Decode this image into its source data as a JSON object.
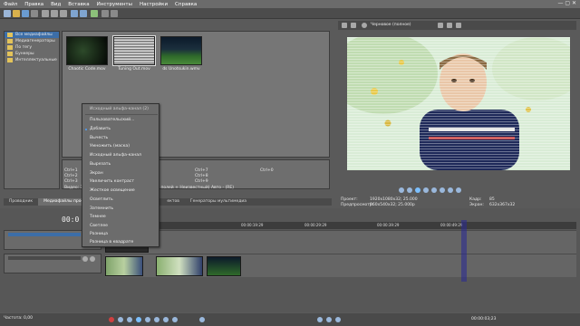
{
  "menu": [
    "Файл",
    "Правка",
    "Вид",
    "Вставка",
    "Инструменты",
    "Настройки",
    "Справка"
  ],
  "explorer": {
    "tree_items": [
      "Все медиафайлы",
      "Медиагенераторы",
      "По тегу",
      "Бункеры",
      "Интеллектуальные"
    ],
    "selected_index": 0
  },
  "media": [
    {
      "label": "Chaotic Code.mov"
    },
    {
      "label": "Tuning Out.mov"
    },
    {
      "label": "ds Unotsukin.wmv"
    }
  ],
  "info": {
    "shortcut_rows": [
      [
        "Ctrl+1",
        "Ctrl+7",
        "Ctrl+0"
      ],
      [
        "Ctrl+2",
        "Ctrl+8",
        ""
      ],
      [
        "Ctrl+3",
        "Ctrl+9",
        ""
      ]
    ],
    "bottom_line": "Видео: 38...  анная + (Отсутствует) Передан полей + Неизвестный) Авто - (RE)",
    "tail_tabs": [
      "ектов",
      "Генераторы мультимедиа"
    ]
  },
  "panel_tabs": [
    "Проводник",
    "Медиафайлы проекта"
  ],
  "preview": {
    "mode": "Черновое (полное)",
    "stats": {
      "project_label": "Проект:",
      "project_value": "1920x1080x32; 25.000",
      "preview_label": "Предпросмотр:",
      "preview_value": "960x540x32; 25.000p",
      "frame_label": "Кадр:",
      "frame_value": "85",
      "display_label": "Экран:",
      "display_value": "632x367x32"
    }
  },
  "context_menu": {
    "header": "Исходный альфа-канал (2)",
    "items": [
      "Пользовательский...",
      "Добавить",
      "Вычесть",
      "Умножить (маска)",
      "Исходный альфа-канал",
      "Вырезать",
      "Экран",
      "Увеличить контраст",
      "Жесткое освещение",
      "Осветлить",
      "Затемнить",
      "Темнее",
      "Светлее",
      "Разница",
      "Разница в квадрате"
    ],
    "checked_index": 1
  },
  "timeline": {
    "timecode": "00:0",
    "ruler_labels": [
      "00:00:19:29",
      "00:00:29:29",
      "00:00:39:29",
      "00:00:49:29"
    ],
    "status": "Частота: 0,00",
    "end_timecode": "00:00:03;23",
    "playhead_color": "#2a2aa0"
  },
  "colors": {
    "menu_bg": "#6b6b6b",
    "panel_bg": "#6a6a6a",
    "accent": "#3c6ea8"
  }
}
